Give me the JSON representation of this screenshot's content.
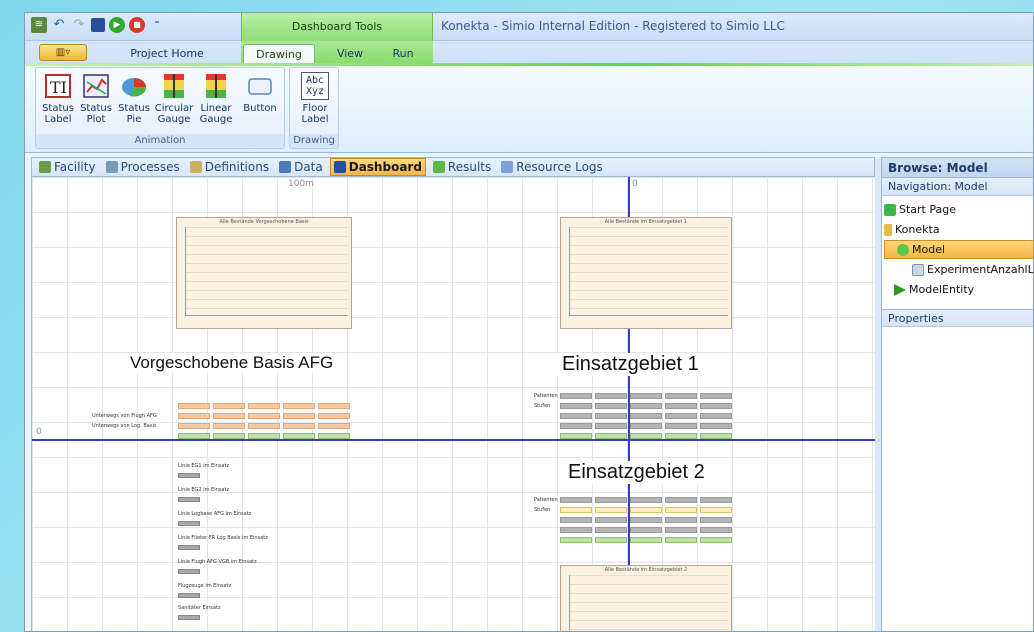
{
  "window": {
    "app_title": "Konekta - Simio Internal Edition - Registered to Simio LLC",
    "context_tab_group": "Dashboard Tools"
  },
  "tabs": {
    "project_home": "Project Home",
    "drawing": "Drawing",
    "view": "View",
    "run": "Run"
  },
  "ribbon": {
    "animation_group": "Animation",
    "drawing_group": "Drawing",
    "buttons": [
      {
        "l1": "Status",
        "l2": "Label"
      },
      {
        "l1": "Status",
        "l2": "Plot"
      },
      {
        "l1": "Status",
        "l2": "Pie"
      },
      {
        "l1": "Circular",
        "l2": "Gauge"
      },
      {
        "l1": "Linear",
        "l2": "Gauge"
      },
      {
        "l1": "Button",
        "l2": ""
      }
    ],
    "floor_label": {
      "l1": "Floor",
      "l2": "Label",
      "icon_text": "Abc Xyz"
    }
  },
  "doc_tabs": [
    "Facility",
    "Processes",
    "Definitions",
    "Data",
    "Dashboard",
    "Results",
    "Resource Logs"
  ],
  "canvas": {
    "ruler_100m": "100m",
    "ruler_zero_top": "0",
    "ruler_zero_left": "0",
    "plot1_title": "Alle Bestände Vorgeschobene Basis",
    "plot2_title": "Alle Bestände im Einsatzgebiet 1",
    "plot3_title": "Alle Bestände im Einsatzgebiet 2",
    "label_basis": "Vorgeschobene Basis AFG",
    "label_eg1": "Einsatzgebiet 1",
    "label_eg2": "Einsatzgebiet 2",
    "row_label_1": "Unterwegs von Flugh.AFG",
    "row_label_2": "Unterwegs von Log. Basis",
    "eg_row_patienten": "Patienten",
    "eg_row_stufen": "Stufen",
    "status_labels": [
      "Linie EG1 im Einsatz",
      "Linie EG2 im Einsatz",
      "Linie Logbase AFG im Einsatz",
      "Linie Flieter FR Log Basis im Einsatz",
      "Linie Flugh AFG VGB im Einsatz",
      "Flugzeuge im Einsatz",
      "Sanitäter Einsatz"
    ]
  },
  "right_panel": {
    "browse_header": "Browse: Model",
    "navigation_header": "Navigation: Model",
    "tree": [
      "Start Page",
      "Konekta",
      "Model",
      "ExperimentAnzahlLk",
      "ModelEntity"
    ],
    "properties_header": "Properties"
  },
  "colors": {
    "accent_green": "#6bd14a",
    "selection_orange": "#f7b444",
    "axis_blue": "#3a3ac8"
  }
}
